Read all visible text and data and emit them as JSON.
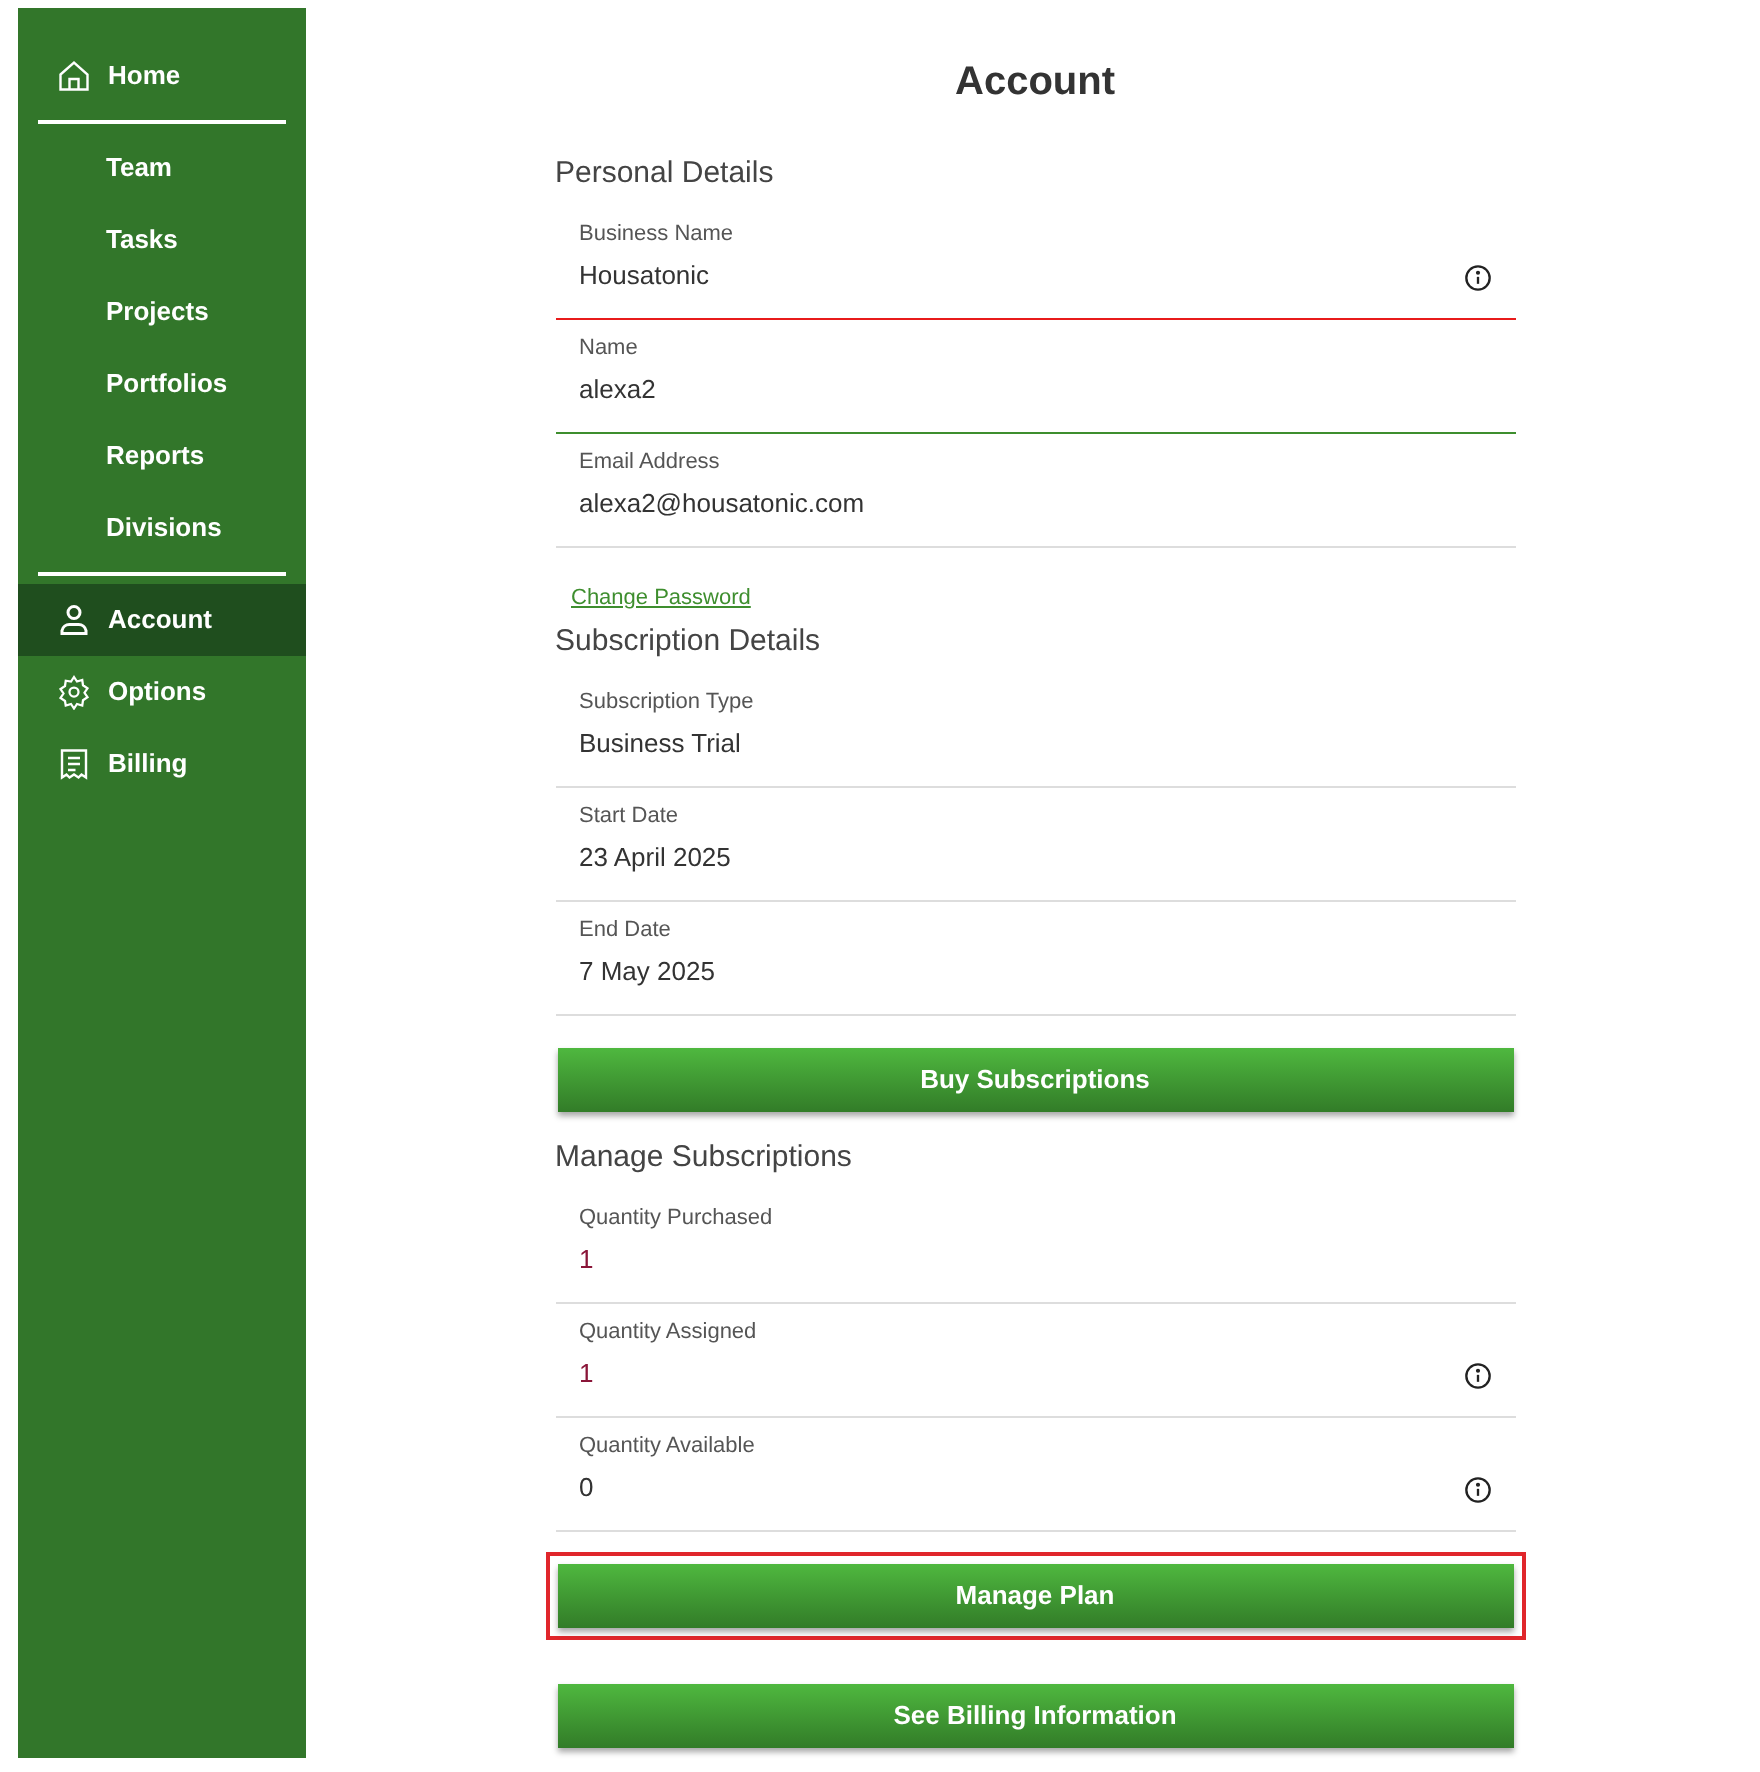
{
  "sidebar": {
    "items": [
      {
        "kind": "main",
        "label": "Home",
        "selected": false
      },
      {
        "kind": "divider"
      },
      {
        "kind": "sub",
        "label": "Team",
        "selected": false
      },
      {
        "kind": "sub",
        "label": "Tasks",
        "selected": false
      },
      {
        "kind": "sub",
        "label": "Projects",
        "selected": false
      },
      {
        "kind": "sub",
        "label": "Portfolios",
        "selected": false
      },
      {
        "kind": "sub",
        "label": "Reports",
        "selected": false
      },
      {
        "kind": "sub",
        "label": "Divisions",
        "selected": false
      },
      {
        "kind": "divider"
      },
      {
        "kind": "main",
        "label": "Account",
        "selected": true
      },
      {
        "kind": "main",
        "label": "Options",
        "selected": false
      },
      {
        "kind": "main",
        "label": "Billing",
        "selected": false
      }
    ]
  },
  "page": {
    "title": "Account",
    "blocks": [
      {
        "kind": "heading",
        "text": "Personal Details"
      },
      {
        "kind": "field",
        "label": "Business Name",
        "value": "Housatonic",
        "error": true,
        "valid": false,
        "info": true,
        "emphasis": false
      },
      {
        "kind": "field",
        "label": "Name",
        "value": "alexa2",
        "error": false,
        "valid": true,
        "info": false,
        "emphasis": false
      },
      {
        "kind": "field",
        "label": "Email Address",
        "value": "alexa2@housatonic.com",
        "error": false,
        "valid": false,
        "info": false,
        "emphasis": false
      },
      {
        "kind": "link",
        "text": "Change Password"
      },
      {
        "kind": "heading",
        "text": "Subscription Details"
      },
      {
        "kind": "field",
        "label": "Subscription Type",
        "value": "Business Trial",
        "error": false,
        "valid": false,
        "info": false,
        "emphasis": false
      },
      {
        "kind": "field",
        "label": "Start Date",
        "value": "23 April 2025",
        "error": false,
        "valid": false,
        "info": false,
        "emphasis": false
      },
      {
        "kind": "field",
        "label": "End Date",
        "value": "7 May 2025",
        "error": false,
        "valid": false,
        "info": false,
        "emphasis": false
      },
      {
        "kind": "button",
        "label": "Buy Subscriptions",
        "highlighted": false
      },
      {
        "kind": "heading",
        "text": "Manage Subscriptions"
      },
      {
        "kind": "field",
        "label": "Quantity Purchased",
        "value": "1",
        "error": false,
        "valid": false,
        "info": false,
        "emphasis": true
      },
      {
        "kind": "field",
        "label": "Quantity Assigned",
        "value": "1",
        "error": false,
        "valid": false,
        "info": true,
        "emphasis": true
      },
      {
        "kind": "field",
        "label": "Quantity Available",
        "value": "0",
        "error": false,
        "valid": false,
        "info": true,
        "emphasis": false
      },
      {
        "kind": "button",
        "label": "Manage Plan",
        "highlighted": true
      },
      {
        "kind": "button",
        "label": "See Billing Information",
        "highlighted": false
      }
    ]
  }
}
